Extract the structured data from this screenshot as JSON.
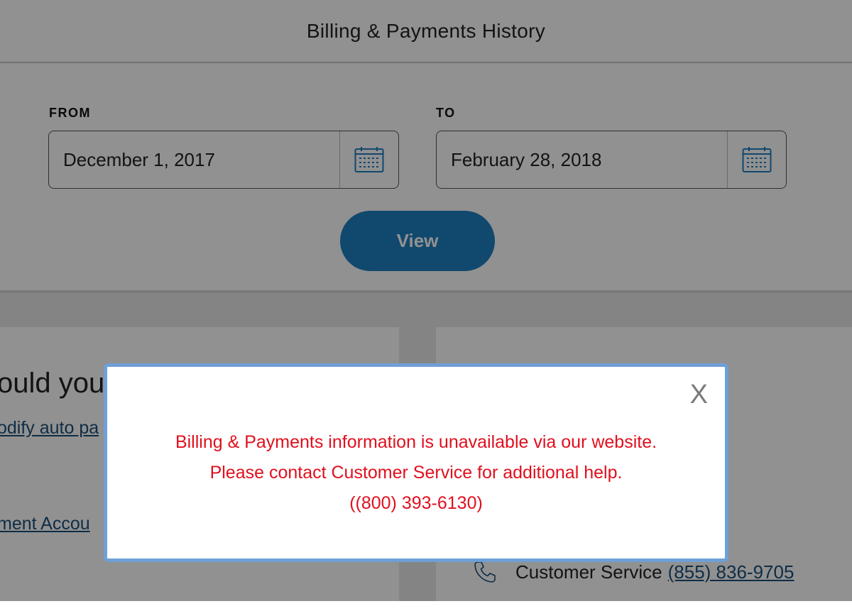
{
  "header": {
    "title": "Billing & Payments History"
  },
  "filters": {
    "from_label": "FROM",
    "from_value": "December 1, 2017",
    "to_label": "TO",
    "to_value": "February 28, 2018",
    "view_label": "View",
    "calendar_icon": "calendar-icon"
  },
  "left_card": {
    "question": "ould you",
    "autopay_link": "odify auto pa",
    "payment_link": "ment Accou"
  },
  "right_card": {
    "cs_label": "Customer Service",
    "cs_phone": "(855) 836-9705",
    "phone_icon": "phone-icon"
  },
  "modal": {
    "close_label": "X",
    "line1": "Billing & Payments information is unavailable via our website.",
    "line2": "Please contact Customer Service for additional help.",
    "line3": "((800) 393-6130)"
  },
  "colors": {
    "accent": "#1f7fc1",
    "error": "#e0101e",
    "modal_border": "#6f9fd7",
    "link": "#1b4f7a"
  }
}
